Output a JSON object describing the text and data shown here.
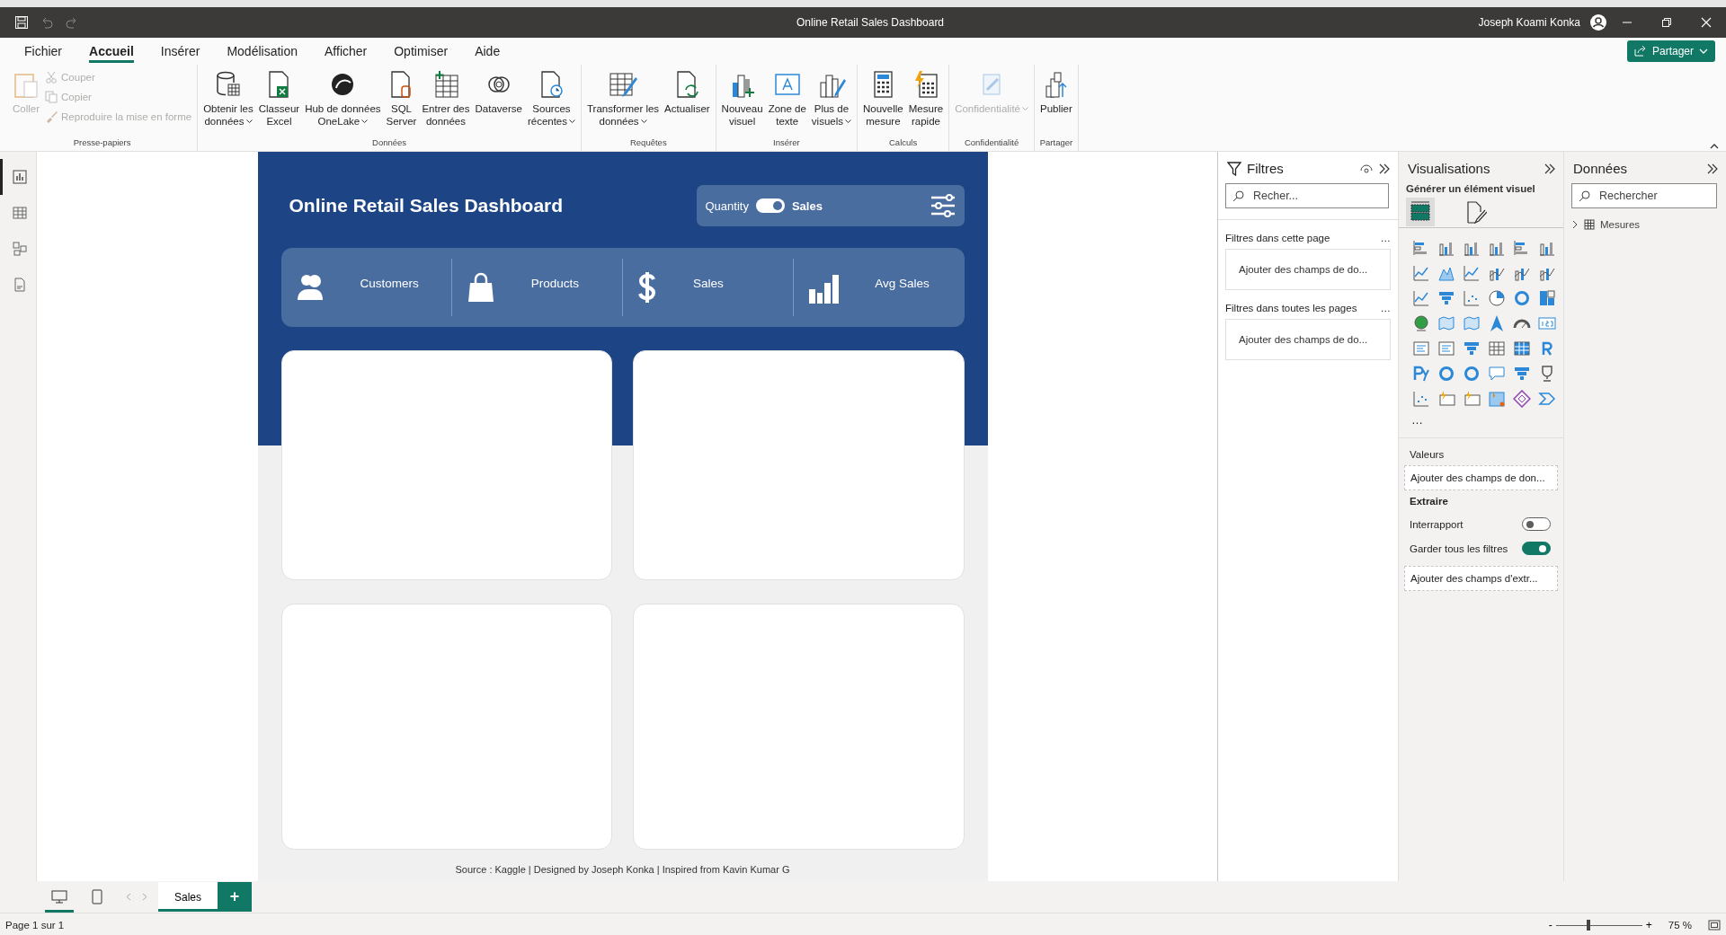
{
  "window": {
    "title": "Online Retail Sales Dashboard",
    "user": "Joseph Koami Konka"
  },
  "menu": [
    {
      "label": "Fichier",
      "selected": false
    },
    {
      "label": "Accueil",
      "selected": true
    },
    {
      "label": "Insérer",
      "selected": false
    },
    {
      "label": "Modélisation",
      "selected": false
    },
    {
      "label": "Afficher",
      "selected": false
    },
    {
      "label": "Optimiser",
      "selected": false
    },
    {
      "label": "Aide",
      "selected": false
    }
  ],
  "share_button": "Partager",
  "ribbon": [
    {
      "group": "Presse-papiers",
      "items": [
        {
          "kind": "large",
          "lines": [
            "Coller"
          ],
          "dropdown": false,
          "disabled": true
        },
        {
          "kind": "small",
          "lines": [
            "Couper"
          ],
          "disabled": true
        },
        {
          "kind": "small",
          "lines": [
            "Copier"
          ],
          "disabled": true
        },
        {
          "kind": "small",
          "lines": [
            "Reproduire la mise en forme"
          ],
          "disabled": true
        }
      ]
    },
    {
      "group": "Données",
      "items": [
        {
          "kind": "large",
          "lines": [
            "Obtenir les",
            "données"
          ],
          "dropdown": true,
          "disabled": false
        },
        {
          "kind": "large",
          "lines": [
            "Classeur",
            "Excel"
          ],
          "dropdown": false,
          "disabled": false
        },
        {
          "kind": "large",
          "lines": [
            "Hub de données",
            "OneLake"
          ],
          "dropdown": true,
          "disabled": false
        },
        {
          "kind": "large",
          "lines": [
            "SQL",
            "Server"
          ],
          "dropdown": false,
          "disabled": false
        },
        {
          "kind": "large",
          "lines": [
            "Entrer des",
            "données"
          ],
          "dropdown": false,
          "disabled": false
        },
        {
          "kind": "large",
          "lines": [
            "Dataverse"
          ],
          "dropdown": false,
          "disabled": false
        },
        {
          "kind": "large",
          "lines": [
            "Sources",
            "récentes"
          ],
          "dropdown": true,
          "disabled": false
        }
      ]
    },
    {
      "group": "Requêtes",
      "items": [
        {
          "kind": "large",
          "lines": [
            "Transformer les",
            "données"
          ],
          "dropdown": true,
          "disabled": false
        },
        {
          "kind": "large",
          "lines": [
            "Actualiser"
          ],
          "dropdown": false,
          "disabled": false
        }
      ]
    },
    {
      "group": "Insérer",
      "items": [
        {
          "kind": "large",
          "lines": [
            "Nouveau",
            "visuel"
          ],
          "dropdown": false,
          "disabled": false
        },
        {
          "kind": "large",
          "lines": [
            "Zone de",
            "texte"
          ],
          "dropdown": false,
          "disabled": false
        },
        {
          "kind": "large",
          "lines": [
            "Plus de",
            "visuels"
          ],
          "dropdown": true,
          "disabled": false
        }
      ]
    },
    {
      "group": "Calculs",
      "items": [
        {
          "kind": "large",
          "lines": [
            "Nouvelle",
            "mesure"
          ],
          "dropdown": false,
          "disabled": false
        },
        {
          "kind": "large",
          "lines": [
            "Mesure",
            "rapide"
          ],
          "dropdown": false,
          "disabled": false
        }
      ]
    },
    {
      "group": "Confidentialité",
      "items": [
        {
          "kind": "large",
          "lines": [
            "Confidentialité"
          ],
          "dropdown": true,
          "disabled": true
        }
      ]
    },
    {
      "group": "Partager",
      "items": [
        {
          "kind": "large",
          "lines": [
            "Publier"
          ],
          "dropdown": false,
          "disabled": false
        }
      ]
    }
  ],
  "views": [
    {
      "selected": true
    },
    {
      "selected": false
    },
    {
      "selected": false
    },
    {
      "selected": false
    }
  ],
  "dashboard": {
    "title": "Online Retail Sales Dashboard",
    "toggle": {
      "left": "Quantity",
      "right": "Sales",
      "on": true
    },
    "kpis": [
      {
        "label": "Customers"
      },
      {
        "label": "Products"
      },
      {
        "label": "Sales"
      },
      {
        "label": "Avg Sales"
      }
    ],
    "footer": "Source : Kaggle |  Designed by Joseph Konka | Inspired from Kavin Kumar G"
  },
  "filters": {
    "title": "Filtres",
    "placeholder": "Recher...",
    "sections": [
      {
        "title": "Filtres dans cette page",
        "more": "…",
        "drop": "Ajouter des champs de do..."
      },
      {
        "title": "Filtres dans toutes les pages",
        "more": "…",
        "drop": "Ajouter des champs de do..."
      }
    ]
  },
  "visualizations": {
    "title": "Visualisations",
    "subtitle": "Générer un élément visuel",
    "build_tabs": [
      {
        "selected": true
      },
      {
        "selected": false
      }
    ],
    "more": "…",
    "values_label": "Valeurs",
    "values_drop": "Ajouter des champs de don...",
    "drill_label": "Extraire",
    "toggles": [
      {
        "label": "Interrapport",
        "on": false
      },
      {
        "label": "Garder tous les filtres",
        "on": true
      }
    ],
    "drill_drop": "Ajouter des champs d'extr..."
  },
  "data": {
    "title": "Données",
    "placeholder": "Rechercher",
    "tree": [
      {
        "label": "Mesures",
        "expanded": false
      }
    ]
  },
  "layouts": [
    {
      "selected": true
    },
    {
      "selected": false
    }
  ],
  "pages": [
    {
      "label": "Sales",
      "selected": true
    }
  ],
  "add_page": "+",
  "status": {
    "page": "Page 1 sur 1",
    "zoom_minus": "-",
    "zoom_plus": "+",
    "level": 0.375,
    "zoom": "75 %"
  }
}
